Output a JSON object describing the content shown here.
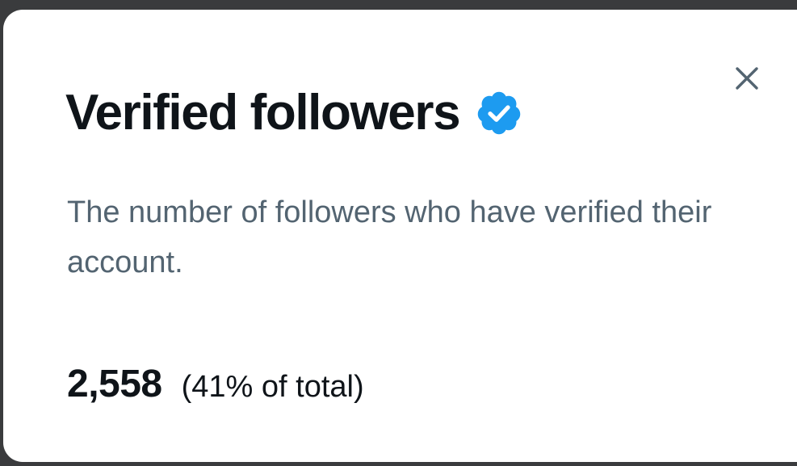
{
  "dialog": {
    "title": "Verified followers",
    "description": "The number of followers who have verified their account.",
    "count": "2,558",
    "percent_text": "(41% of total)",
    "close_icon": "close-icon",
    "badge_icon": "verified-badge-icon"
  },
  "colors": {
    "badge": "#1d9bf0",
    "title": "#0f1419",
    "description": "#536471",
    "close": "#536471",
    "background": "#ffffff"
  }
}
